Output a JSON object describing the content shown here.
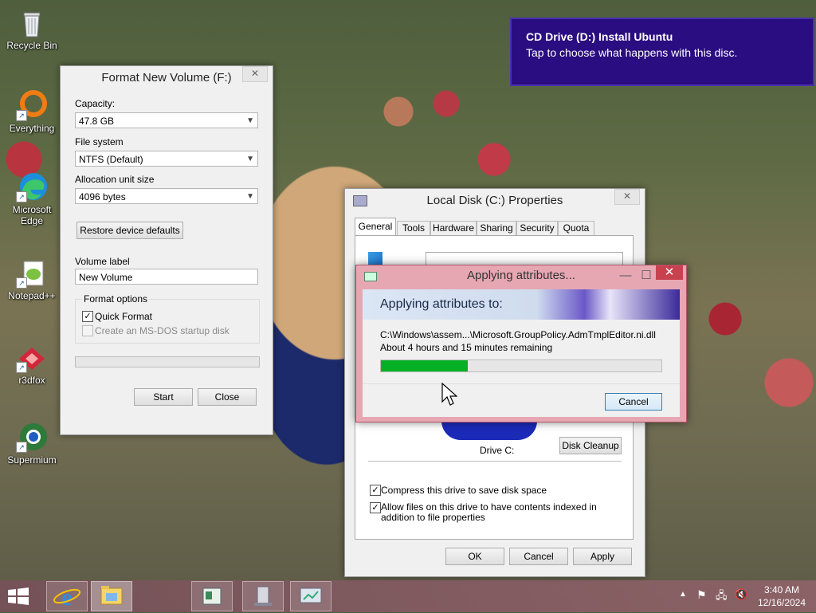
{
  "desktop": {
    "icons": [
      {
        "label": "Recycle Bin",
        "icon": "recycle-bin-icon"
      },
      {
        "label": "Everything",
        "icon": "everything-icon"
      },
      {
        "label": "Microsoft Edge",
        "icon": "edge-icon"
      },
      {
        "label": "Notepad++",
        "icon": "notepadpp-icon"
      },
      {
        "label": "r3dfox",
        "icon": "r3dfox-icon"
      },
      {
        "label": "Supermium",
        "icon": "supermium-icon"
      }
    ]
  },
  "toast": {
    "title": "CD Drive (D:) Install Ubuntu",
    "message": "Tap to choose what happens with this disc."
  },
  "format": {
    "title": "Format New Volume (F:)",
    "capacity_label": "Capacity:",
    "capacity_value": "47.8 GB",
    "fs_label": "File system",
    "fs_value": "NTFS (Default)",
    "alloc_label": "Allocation unit size",
    "alloc_value": "4096 bytes",
    "restore_label": "Restore device defaults",
    "volume_label": "Volume label",
    "volume_value": "New Volume",
    "options_label": "Format options",
    "quick_label": "Quick Format",
    "quick_checked": true,
    "msdos_label": "Create an MS-DOS startup disk",
    "msdos_checked": false,
    "start_label": "Start",
    "close_label": "Close"
  },
  "props": {
    "title": "Local Disk (C:) Properties",
    "tabs": [
      "General",
      "Tools",
      "Hardware",
      "Sharing",
      "Security",
      "Quota"
    ],
    "drive_label": "Drive C:",
    "cleanup_label": "Disk Cleanup",
    "compress_label": "Compress this drive to save disk space",
    "compress_checked": true,
    "index_label": "Allow files on this drive to have contents indexed in addition to file properties",
    "index_checked": true,
    "ok_label": "OK",
    "cancel_label": "Cancel",
    "apply_label": "Apply"
  },
  "applying": {
    "title": "Applying attributes...",
    "heading": "Applying attributes to:",
    "path": "C:\\Windows\\assem...\\Microsoft.GroupPolicy.AdmTmplEditor.ni.dll",
    "remaining": "About 4 hours and 15 minutes remaining",
    "progress": 0.31,
    "cancel_label": "Cancel"
  },
  "taskbar": {
    "time": "3:40 AM",
    "date": "12/16/2024",
    "accent": "#1f4ea8"
  }
}
